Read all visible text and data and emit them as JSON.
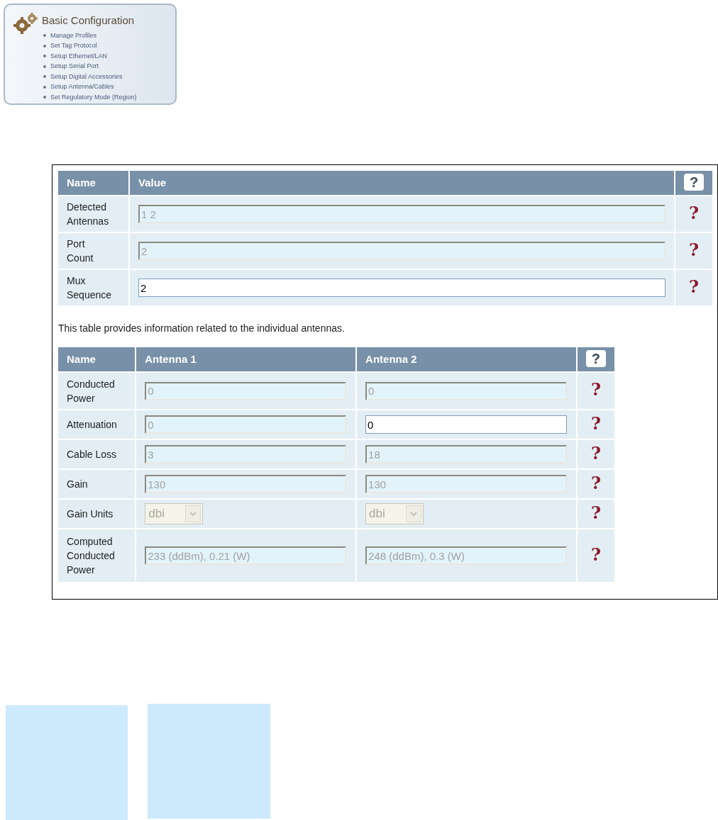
{
  "nav": {
    "title": "Basic Configuration",
    "items": [
      {
        "label": "Manage Profiles"
      },
      {
        "label": "Set Tag Protocol"
      },
      {
        "label": "Setup Ethernet/LAN"
      },
      {
        "label": "Setup Serial Port"
      },
      {
        "label": "Setup Digital Accessories"
      },
      {
        "label": "Setup Antenna/Cables"
      },
      {
        "label": "Set Regulatory Mode (Region)"
      }
    ]
  },
  "settings_table": {
    "columns": [
      "Name",
      "Value"
    ],
    "help_header": "?",
    "rows": [
      {
        "name": "Detected Antennas",
        "value": "1 2",
        "disabled": true,
        "help": "?"
      },
      {
        "name": "Port Count",
        "value": "2",
        "disabled": true,
        "help": "?"
      },
      {
        "name": "Mux Sequence",
        "value": "2",
        "disabled": false,
        "help": "?"
      }
    ]
  },
  "note": "This table provides information related to the individual antennas.",
  "antenna_table": {
    "name_header": "Name",
    "antenna_columns": [
      "Antenna 1",
      "Antenna 2"
    ],
    "help_header": "?",
    "rows": [
      {
        "name": "Conducted Power",
        "kind": "text",
        "cells": [
          {
            "value": "0",
            "disabled": true
          },
          {
            "value": "0",
            "disabled": true
          }
        ],
        "help": "?"
      },
      {
        "name": "Attenuation",
        "kind": "text",
        "cells": [
          {
            "value": "0",
            "disabled": true
          },
          {
            "value": "0",
            "disabled": false
          }
        ],
        "help": "?"
      },
      {
        "name": "Cable Loss",
        "kind": "text",
        "cells": [
          {
            "value": "3",
            "disabled": true
          },
          {
            "value": "18",
            "disabled": true
          }
        ],
        "help": "?"
      },
      {
        "name": "Gain",
        "kind": "text",
        "cells": [
          {
            "value": "130",
            "disabled": true
          },
          {
            "value": "130",
            "disabled": true
          }
        ],
        "help": "?"
      },
      {
        "name": "Gain Units",
        "kind": "select",
        "cells": [
          {
            "value": "dbi",
            "disabled": true
          },
          {
            "value": "dbi",
            "disabled": true
          }
        ],
        "help": "?"
      },
      {
        "name": "Computed Conducted Power",
        "kind": "text",
        "cells": [
          {
            "value": "233 (ddBm), 0.21 (W)",
            "disabled": true
          },
          {
            "value": "248 (ddBm), 0.3 (W)",
            "disabled": true
          }
        ],
        "help": "?"
      }
    ]
  }
}
